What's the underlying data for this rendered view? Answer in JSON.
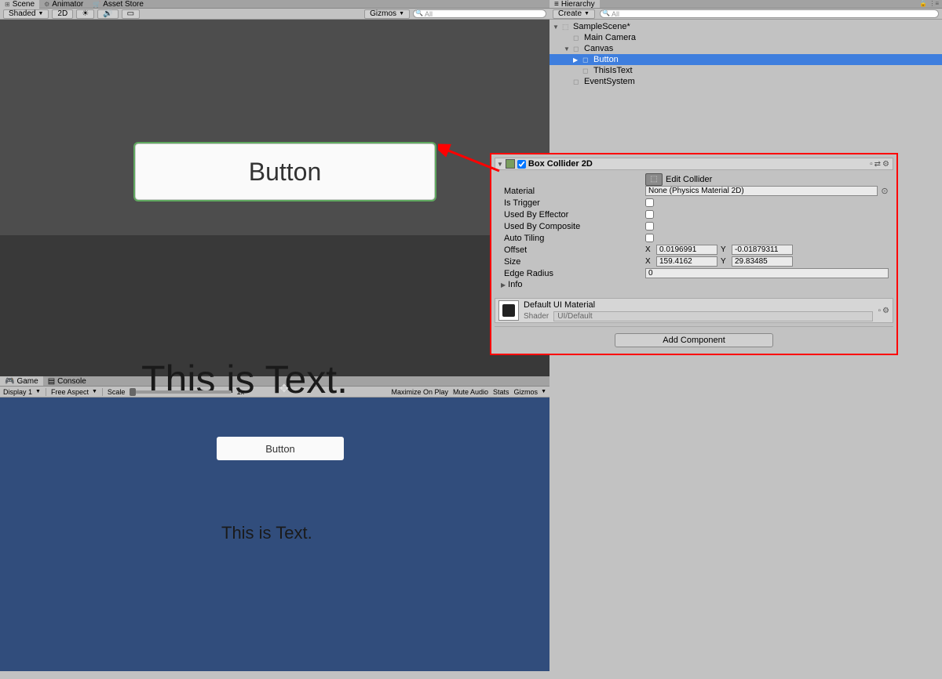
{
  "tabs": {
    "scene": "Scene",
    "animator": "Animator",
    "assetStore": "Asset Store"
  },
  "sceneToolbar": {
    "shaded": "Shaded",
    "mode2d": "2D",
    "gizmos": "Gizmos",
    "searchAll": "All"
  },
  "sceneContent": {
    "buttonLabel": "Button",
    "textLabel": "This is Text."
  },
  "gameTabs": {
    "game": "Game",
    "console": "Console"
  },
  "gameToolbar": {
    "display": "Display 1",
    "aspect": "Free Aspect",
    "scaleLabel": "Scale",
    "scaleValue": "1x",
    "maximize": "Maximize On Play",
    "mute": "Mute Audio",
    "stats": "Stats",
    "gizmos": "Gizmos"
  },
  "gameContent": {
    "buttonLabel": "Button",
    "textLabel": "This is Text."
  },
  "hierarchy": {
    "tab": "Hierarchy",
    "create": "Create",
    "scene": "SampleScene*",
    "items": [
      "Main Camera",
      "Canvas",
      "Button",
      "ThisIsText",
      "EventSystem"
    ]
  },
  "inspector": {
    "componentTitle": "Box Collider 2D",
    "editCollider": "Edit Collider",
    "materialLabel": "Material",
    "materialValue": "None (Physics Material 2D)",
    "isTrigger": "Is Trigger",
    "usedByEffector": "Used By Effector",
    "usedByComposite": "Used By Composite",
    "autoTiling": "Auto Tiling",
    "offsetLabel": "Offset",
    "offsetX": "0.0196991",
    "offsetY": "-0.01879311",
    "sizeLabel": "Size",
    "sizeX": "159.4162",
    "sizeY": "29.83485",
    "edgeRadiusLabel": "Edge Radius",
    "edgeRadius": "0",
    "infoLabel": "Info",
    "defaultMaterial": "Default UI Material",
    "shaderLabel": "Shader",
    "shaderValue": "UI/Default",
    "addComponent": "Add Component"
  }
}
